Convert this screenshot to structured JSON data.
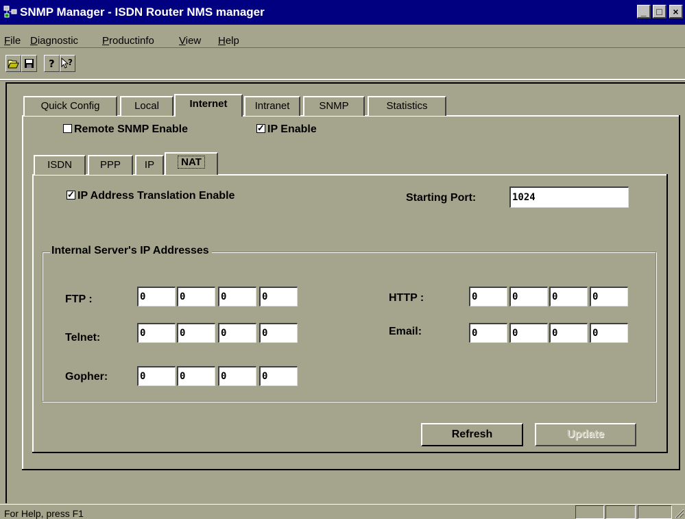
{
  "window": {
    "title": "SNMP Manager - ISDN Router NMS manager",
    "icon": "network-computers-icon"
  },
  "menu": [
    {
      "label": "File",
      "mnemonic": "F",
      "rest": "ile"
    },
    {
      "label": "Diagnostic",
      "mnemonic": "D",
      "rest": "iagnostic"
    },
    {
      "label": "Productinfo",
      "mnemonic": "P",
      "rest": "roductinfo"
    },
    {
      "label": "View",
      "mnemonic": "V",
      "rest": "iew"
    },
    {
      "label": "Help",
      "mnemonic": "H",
      "rest": "elp"
    }
  ],
  "toolbar": [
    "open-folder-icon",
    "save-disk-icon",
    "help-icon",
    "context-help-icon"
  ],
  "main_tabs": {
    "quick_config": "Quick Config",
    "local": "Local",
    "internet": "Internet",
    "intranet": "Intranet",
    "snmp": "SNMP",
    "statistics": "Statistics",
    "selected": "Internet"
  },
  "options": {
    "remote_snmp": {
      "label": "Remote SNMP Enable",
      "checked": false
    },
    "ip_enable": {
      "label": "IP Enable",
      "checked": true
    }
  },
  "sub_tabs": {
    "isdn": "ISDN",
    "ppp": "PPP",
    "ip": "IP",
    "nat": "NAT",
    "selected": "NAT"
  },
  "nat": {
    "translation": {
      "label": "IP Address Translation Enable",
      "checked": true
    },
    "starting_port": {
      "label": "Starting Port:",
      "value": "1024"
    },
    "group_label": "Internal Server's IP Addresses",
    "ftp": {
      "label": "FTP :",
      "octets": [
        "0",
        "0",
        "0",
        "0"
      ]
    },
    "telnet": {
      "label": "Telnet:",
      "octets": [
        "0",
        "0",
        "0",
        "0"
      ]
    },
    "gopher": {
      "label": "Gopher:",
      "octets": [
        "0",
        "0",
        "0",
        "0"
      ]
    },
    "http": {
      "label": "HTTP :",
      "octets": [
        "0",
        "0",
        "0",
        "0"
      ]
    },
    "email": {
      "label": "Email:",
      "octets": [
        "0",
        "0",
        "0",
        "0"
      ]
    }
  },
  "buttons": {
    "refresh": "Refresh",
    "update": "Update"
  },
  "status": {
    "text": "For Help, press F1"
  }
}
